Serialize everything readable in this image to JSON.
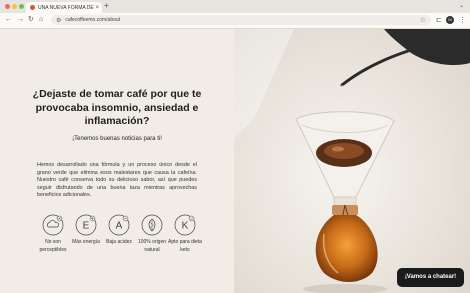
{
  "browser": {
    "tab_title": "UNA NUEVA FORMA DE TOMAR CAFÉ",
    "tab_close": "×",
    "new_tab": "+",
    "url": "cafecoffeemo.com/about",
    "back_icon": "←",
    "forward_icon": "→",
    "reload_icon": "↻",
    "home_icon": "⌂",
    "site_info_icon": "⚙",
    "bookmark_icon": "☆",
    "cast_icon": "⊏",
    "sidebar_icon": "▯",
    "avatar": "M",
    "menu_icon": "⋮",
    "tab_list_icon": "⌄",
    "colors": {
      "close": "#ec6a5e",
      "minimize": "#f4bf4f",
      "maximize": "#61c554"
    }
  },
  "hero": {
    "headline": "¿Dejaste de tomar café por que te provocaba insomnio, ansiedad e inflamación?",
    "subheadline": "¡Tenemos buenas noticias para ti!",
    "paragraph": "Hemos desarrollado una fórmula y un proceso único desde el grano verde que elimina esos malestares que causa la cafeína. Nuestro café conserva todo su delicioso sabor, así que puedes seguir disfrutando de una buena taza mientras aprovechas beneficios adicionales."
  },
  "benefits": [
    {
      "label": "No son perceptibles",
      "icon": "cloud-x-icon"
    },
    {
      "label": "Más energía",
      "icon": "letter-e-plus-icon",
      "glyph": "E"
    },
    {
      "label": "Baja acidez",
      "icon": "letter-a-minus-icon",
      "glyph": "A"
    },
    {
      "label": "100% origen natural",
      "icon": "leaf-icon"
    },
    {
      "label": "Apto para dieta keto",
      "icon": "letter-k-check-icon",
      "glyph": "K"
    }
  ],
  "chat": {
    "label": "¡Vamos a chatear!"
  }
}
